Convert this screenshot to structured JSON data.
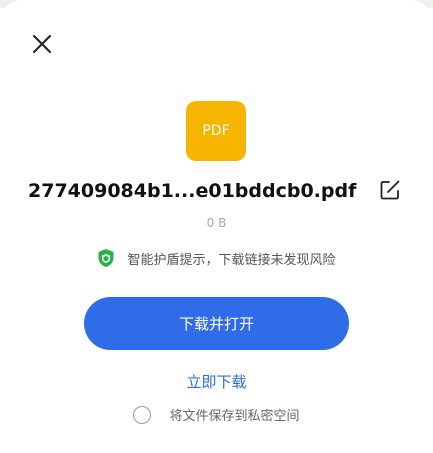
{
  "dialog": {
    "file_type_label": "PDF",
    "file_name": "277409084b1...e01bddcb0.pdf",
    "file_size": "0 B",
    "safety_notice": "智能护盾提示，下载链接未发现风险",
    "primary_button": "下载并打开",
    "secondary_link": "立即下载",
    "private_option": "将文件保存到私密空间",
    "private_option_checked": false
  },
  "icons": {
    "close": "close-icon",
    "edit": "edit-icon",
    "shield": "shield-icon",
    "pdf": "pdf-file-icon"
  },
  "colors": {
    "primary": "#2f6ce8",
    "link": "#2b6de4",
    "pdf_icon": "#F7B500",
    "shield": "#27b24a"
  }
}
